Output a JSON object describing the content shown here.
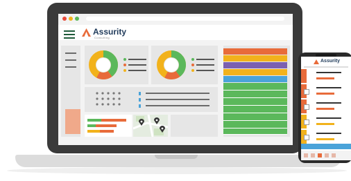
{
  "brand": {
    "name": "Assurity",
    "subtitle": "Consulting"
  },
  "colors": {
    "green": "#5bb85b",
    "orange": "#e86b3a",
    "yellow": "#f2b21b",
    "purple": "#7b5fb0",
    "blue": "#4aa3d9",
    "dark_green": "#1e5b3a",
    "salmon": "#f0a98a"
  },
  "icons": [
    "hamburger-icon",
    "assurity-logo-icon",
    "map-pin-icon"
  ]
}
